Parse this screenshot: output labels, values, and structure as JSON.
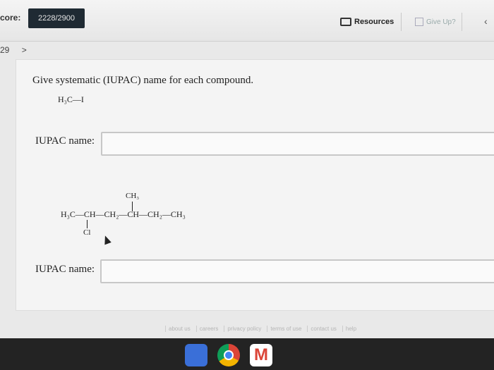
{
  "header": {
    "score_label": "core:",
    "score_value": "2228/2900",
    "resources_label": "Resources",
    "giveup_label": "Give Up?"
  },
  "qnav": {
    "number": "29",
    "next_arrow": ">"
  },
  "question": {
    "prompt": "Give systematic (IUPAC) name for each compound.",
    "compound1": "H₃C—I",
    "iupac_label1": "IUPAC name:",
    "compound2_branch_top": "CH₃",
    "compound2_main": "H₃C—CH—CH₂—CH—CH₂—CH₃",
    "compound2_branch_bottom": "Cl",
    "iupac_label2": "IUPAC name:",
    "answer1": "",
    "answer2": ""
  },
  "footer": {
    "links": [
      "about us",
      "careers",
      "privacy policy",
      "terms of use",
      "contact us",
      "help"
    ]
  },
  "dock": [
    "docs-icon",
    "chrome-icon",
    "gmail-icon"
  ]
}
